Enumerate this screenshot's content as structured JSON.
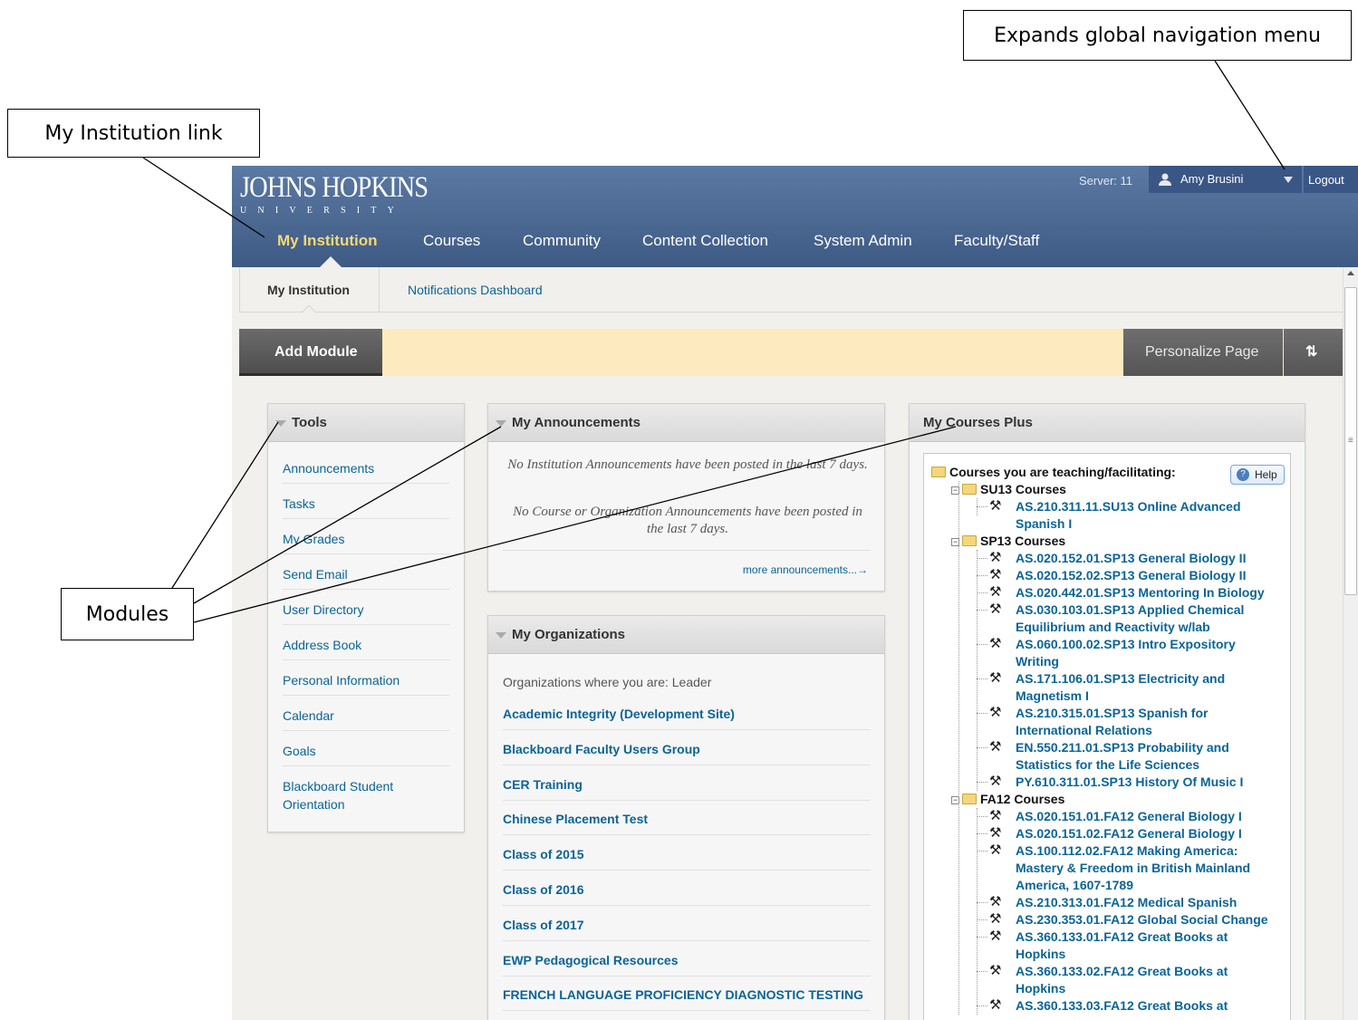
{
  "callouts": {
    "global_nav": "Expands global navigation menu",
    "my_institution": "My Institution link",
    "modules": "Modules"
  },
  "header": {
    "logo_main": "JOHNS HOPKINS",
    "logo_sub": "UNIVERSITY",
    "server": "Server: 11",
    "user_name": "Amy Brusini",
    "logout": "Logout"
  },
  "global_nav": [
    "My Institution",
    "Courses",
    "Community",
    "Content Collection",
    "System Admin",
    "Faculty/Staff"
  ],
  "sub_tabs": {
    "active": "My Institution",
    "other": "Notifications Dashboard"
  },
  "module_bar": {
    "add_module": "Add Module",
    "personalize": "Personalize Page",
    "reorder": "⇅"
  },
  "tools": {
    "title": "Tools",
    "items": [
      "Announcements",
      "Tasks",
      "My Grades",
      "Send Email",
      "User Directory",
      "Address Book",
      "Personal Information",
      "Calendar",
      "Goals",
      "Blackboard Student Orientation"
    ]
  },
  "announcements": {
    "title": "My Announcements",
    "institution_msg": "No Institution Announcements have been posted in the last 7 days.",
    "course_msg": "No Course or Organization Announcements have been posted in the last 7 days.",
    "more": "more announcements...→"
  },
  "organizations": {
    "title": "My Organizations",
    "intro": "Organizations where you are: Leader",
    "items": [
      "Academic Integrity (Development Site)",
      "Blackboard Faculty Users Group",
      "CER Training",
      "Chinese Placement Test",
      "Class of 2015",
      "Class of 2016",
      "Class of 2017",
      "EWP Pedagogical Resources",
      "FRENCH LANGUAGE PROFICIENCY DIAGNOSTIC TESTING"
    ]
  },
  "courses": {
    "title": "My Courses Plus",
    "root": "Courses you are teaching/facilitating:",
    "help": "Help",
    "terms": [
      {
        "name": "SU13 Courses",
        "courses": [
          [
            "AS.210.311.11.SU13 Online Advanced",
            "Spanish I"
          ]
        ]
      },
      {
        "name": "SP13 Courses",
        "courses": [
          [
            "AS.020.152.01.SP13 General Biology II"
          ],
          [
            "AS.020.152.02.SP13 General Biology II"
          ],
          [
            "AS.020.442.01.SP13 Mentoring In Biology"
          ],
          [
            "AS.030.103.01.SP13 Applied Chemical",
            "Equilibrium and Reactivity w/lab"
          ],
          [
            "AS.060.100.02.SP13 Intro Expository",
            "Writing"
          ],
          [
            "AS.171.106.01.SP13 Electricity and",
            "Magnetism I"
          ],
          [
            "AS.210.315.01.SP13 Spanish for",
            "International Relations"
          ],
          [
            "EN.550.211.01.SP13 Probability and",
            "Statistics for the Life Sciences"
          ],
          [
            "PY.610.311.01.SP13 History Of Music I"
          ]
        ]
      },
      {
        "name": "FA12 Courses",
        "courses": [
          [
            "AS.020.151.01.FA12 General Biology I"
          ],
          [
            "AS.020.151.02.FA12 General Biology I"
          ],
          [
            "AS.100.112.02.FA12 Making America:",
            "Mastery & Freedom in British Mainland",
            "America, 1607-1789"
          ],
          [
            "AS.210.313.01.FA12 Medical Spanish"
          ],
          [
            "AS.230.353.01.FA12 Global Social Change"
          ],
          [
            "AS.360.133.01.FA12 Great Books at",
            "Hopkins"
          ],
          [
            "AS.360.133.02.FA12 Great Books at",
            "Hopkins"
          ],
          [
            "AS.360.133.03.FA12 Great Books at"
          ]
        ]
      }
    ]
  }
}
